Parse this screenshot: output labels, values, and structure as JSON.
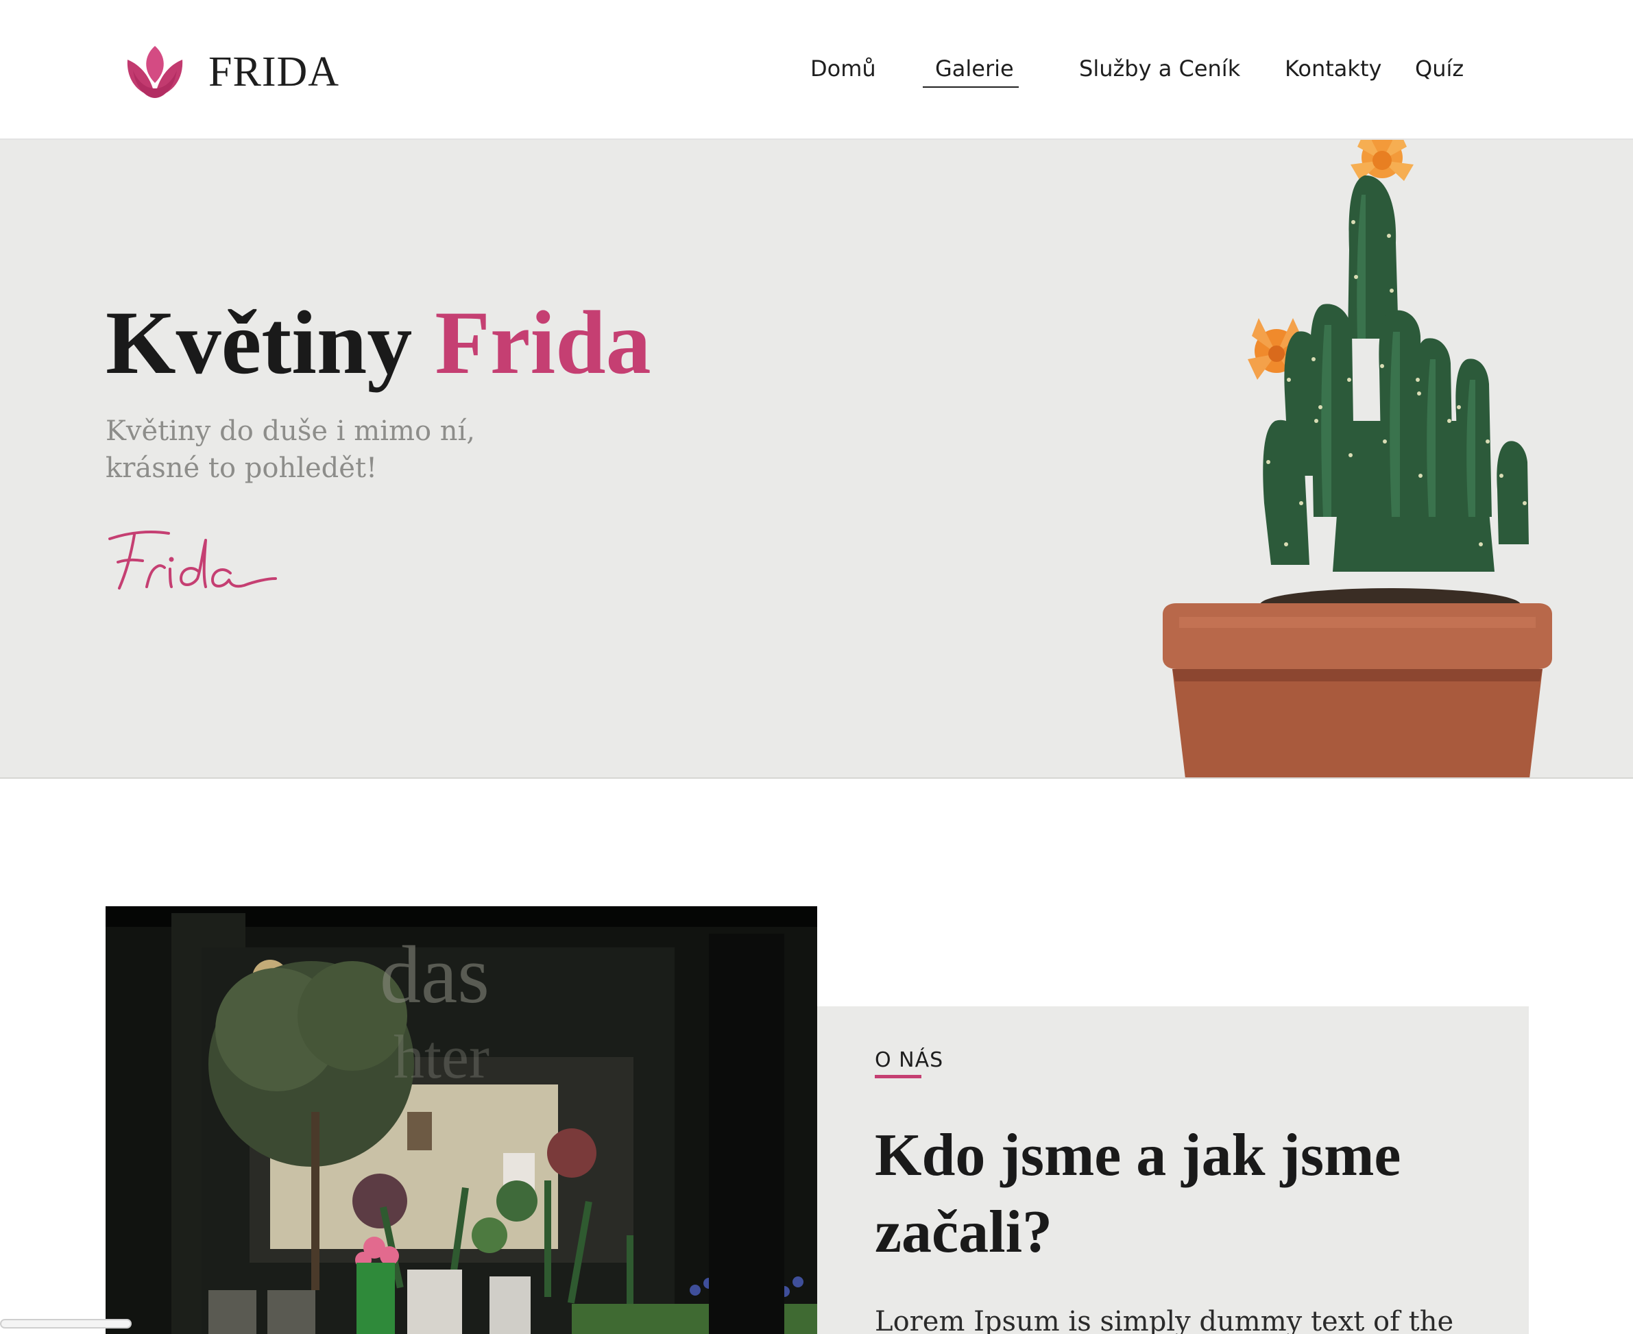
{
  "brand": {
    "name": "FRIDA",
    "logo_icon": "tulip-icon",
    "accent_color": "#c53f72"
  },
  "nav": {
    "items": [
      {
        "label": "Domů"
      },
      {
        "label": "Galerie",
        "active": true
      },
      {
        "label": "Služby a Ceník"
      },
      {
        "label": "Kontakty"
      },
      {
        "label": "Quíz"
      }
    ]
  },
  "hero": {
    "title_main": "Květiny",
    "title_accent": "Frida",
    "subtitle_line1": "Květiny do duše i mimo ní,",
    "subtitle_line2": "krásné to pohledět!",
    "signature": "Frida",
    "image_icon": "potted-cactus-image"
  },
  "about": {
    "eyebrow": "O NÁS",
    "heading_line1": "Kdo jsme a jak jsme",
    "heading_line2": "začali?",
    "body": "Lorem Ipsum is simply dummy text of the",
    "image_icon": "flower-shop-window-photo"
  }
}
